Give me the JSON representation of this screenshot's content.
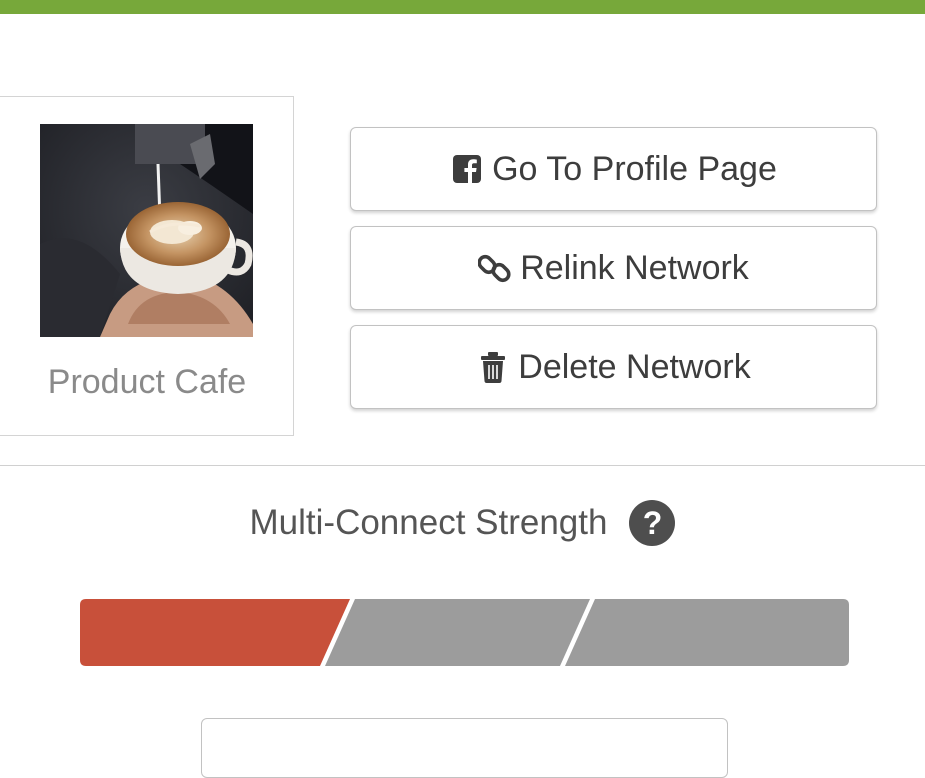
{
  "profile": {
    "name": "Product Cafe",
    "image_description": "latte-art-cup-photo"
  },
  "actions": {
    "go_to_profile": {
      "label": "Go To Profile Page",
      "icon": "facebook-square-icon"
    },
    "relink": {
      "label": "Relink Network",
      "icon": "link-icon"
    },
    "delete": {
      "label": "Delete Network",
      "icon": "trash-icon"
    }
  },
  "strength": {
    "title": "Multi-Connect Strength",
    "help_glyph": "?",
    "segments_total": 3,
    "segments_filled": 1,
    "fill_color": "#c8503a",
    "empty_color": "#9c9c9c"
  },
  "colors": {
    "topbar": "#77a83a"
  }
}
